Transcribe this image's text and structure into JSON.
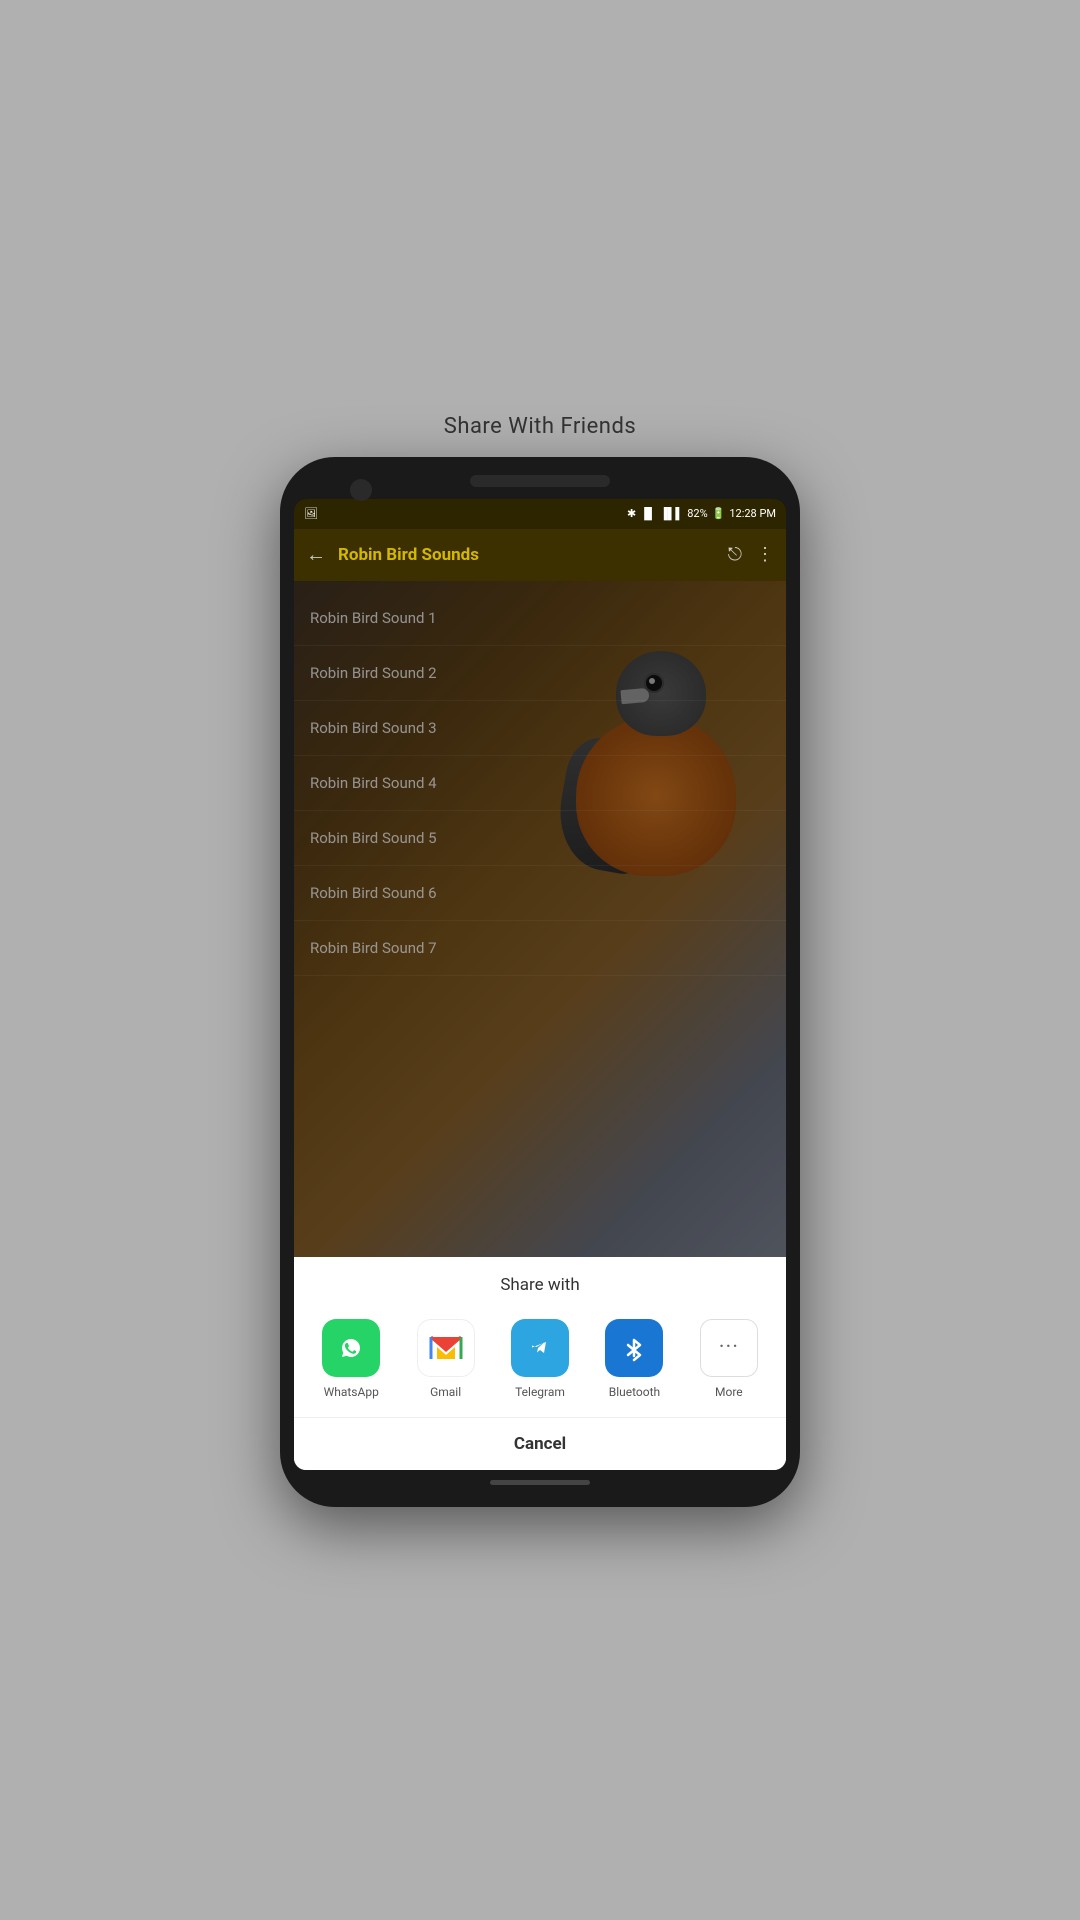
{
  "page": {
    "title": "Share With Friends"
  },
  "status_bar": {
    "time": "12:28 PM",
    "battery": "82%",
    "signal": "▐▌▌"
  },
  "app_bar": {
    "title": "Robin Bird Sounds",
    "back_label": "←",
    "share_label": "share",
    "more_label": "⋮"
  },
  "sound_list": {
    "items": [
      "Robin Bird Sound 1",
      "Robin Bird Sound 2",
      "Robin Bird Sound 3",
      "Robin Bird Sound 4",
      "Robin Bird Sound 5",
      "Robin Bird Sound 6",
      "Robin Bird Sound 7"
    ]
  },
  "share_sheet": {
    "title": "Share with",
    "apps": [
      {
        "id": "whatsapp",
        "label": "WhatsApp"
      },
      {
        "id": "gmail",
        "label": "Gmail"
      },
      {
        "id": "telegram",
        "label": "Telegram"
      },
      {
        "id": "bluetooth",
        "label": "Bluetooth"
      },
      {
        "id": "more",
        "label": "More"
      }
    ],
    "cancel_label": "Cancel"
  }
}
